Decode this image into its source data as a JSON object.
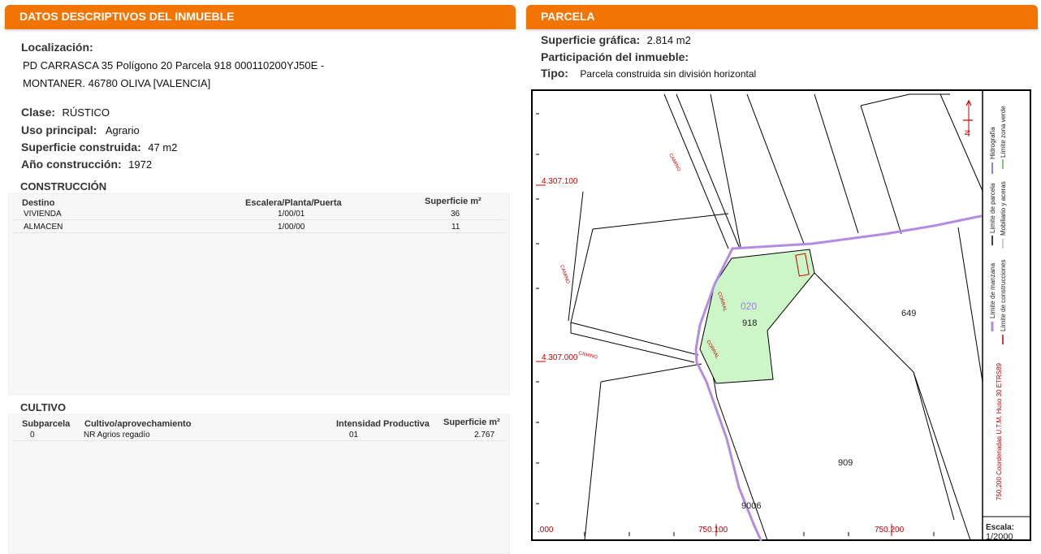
{
  "left_panel": {
    "title": "DATOS DESCRIPTIVOS DEL INMUEBLE",
    "localizacion_label": "Localización:",
    "localizacion_line1": "PD CARRASCA 35 Polígono 20 Parcela 918 000110200YJ50E -",
    "localizacion_line2": "MONTANER. 46780 OLIVA [VALENCIA]",
    "clase_label": "Clase:",
    "clase_value": "RÚSTICO",
    "uso_label": "Uso principal:",
    "uso_value": "Agrario",
    "superficie_label": "Superficie construida:",
    "superficie_value": "47 m2",
    "anio_label": "Año construcción:",
    "anio_value": "1972"
  },
  "construccion": {
    "title": "CONSTRUCCIÓN",
    "headers": [
      "Destino",
      "Escalera/Planta/Puerta",
      "Superficie m²"
    ],
    "rows": [
      {
        "destino": "VIVIENDA",
        "planta": "1/00/01",
        "superficie": "36"
      },
      {
        "destino": "ALMACEN",
        "planta": "1/00/00",
        "superficie": "11"
      }
    ]
  },
  "cultivo": {
    "title": "CULTIVO",
    "headers": [
      "Subparcela",
      "Cultivo/aprovechamiento",
      "Intensidad Productiva",
      "Superficie m²"
    ],
    "rows": [
      {
        "subparcela": "0",
        "cultivo": "NR Agrios regadío",
        "intensidad": "01",
        "superficie": "2.767"
      }
    ]
  },
  "right_panel": {
    "title": "PARCELA",
    "sup_grafica_label": "Superficie gráfica:",
    "sup_grafica_value": "2.814 m2",
    "participacion_label": "Participación del inmueble:",
    "tipo_label": "Tipo:",
    "tipo_value": "Parcela construida sin división horizontal"
  },
  "map": {
    "coord_y_top": "4.307.100",
    "coord_y_bottom": "4.307.000",
    "coord_x_left": ".000",
    "coord_x_mid": "750.100",
    "coord_x_right": "750.200",
    "parcel_polygon": "020",
    "parcel_number": "918",
    "neighbor_649": "649",
    "neighbor_909": "909",
    "neighbor_9006": "9006",
    "camino_labels": [
      "CAMINO",
      "CAMINO",
      "CAMINO"
    ],
    "corral_labels": [
      "CORRAL",
      "CORRAL"
    ],
    "north_label": "N",
    "parcel_fill_color": "#ccf5c8",
    "hydro_color": "#b38be3",
    "legend": {
      "limite_manzana": "Límite de manzana",
      "limite_parcela": "Límite de parcela",
      "hidrografia": "Hidrografía",
      "limite_construcciones": "Límite de construcciones",
      "mobiliario": "Mobiliario y aceras",
      "limite_zona_verde": "Límite zona verde",
      "coordenadas": "750,200 Coordenadas U.T.M. Huso 30 ETRS89"
    },
    "escala_label": "Escala:",
    "escala_value": "1/2000"
  }
}
